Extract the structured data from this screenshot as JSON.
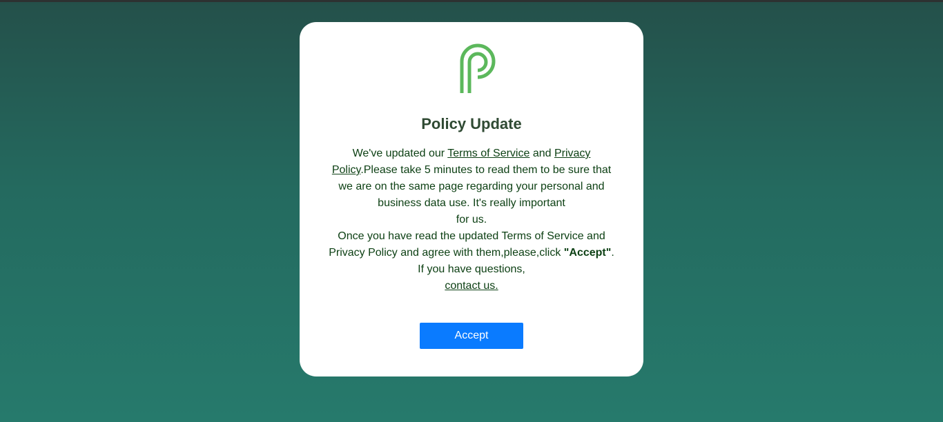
{
  "modal": {
    "logo_icon": "android-p-logo-icon",
    "logo_color": "#5cb85c",
    "title": "Policy Update",
    "p1_pre": "We've updated our ",
    "p1_link_terms": "Terms of Service",
    "p1_and": " and ",
    "p1_link_privacy": "Privacy Policy",
    "p1_rest": ".Please take 5 minutes to read them to be sure that we are on the same page regarding your personal and business data use. It's really important",
    "p1_end": "for us.",
    "p2_pre": "Once you have read the updated Terms of Service and Privacy Policy and agree with them,please,click ",
    "p2_bold": "\"Accept\"",
    "p2_end": ".",
    "p3": "If you have questions,",
    "contact_link": "contact us.",
    "accept_label": "Accept",
    "accent_color": "#0a7bff",
    "text_color": "#0d4014"
  }
}
